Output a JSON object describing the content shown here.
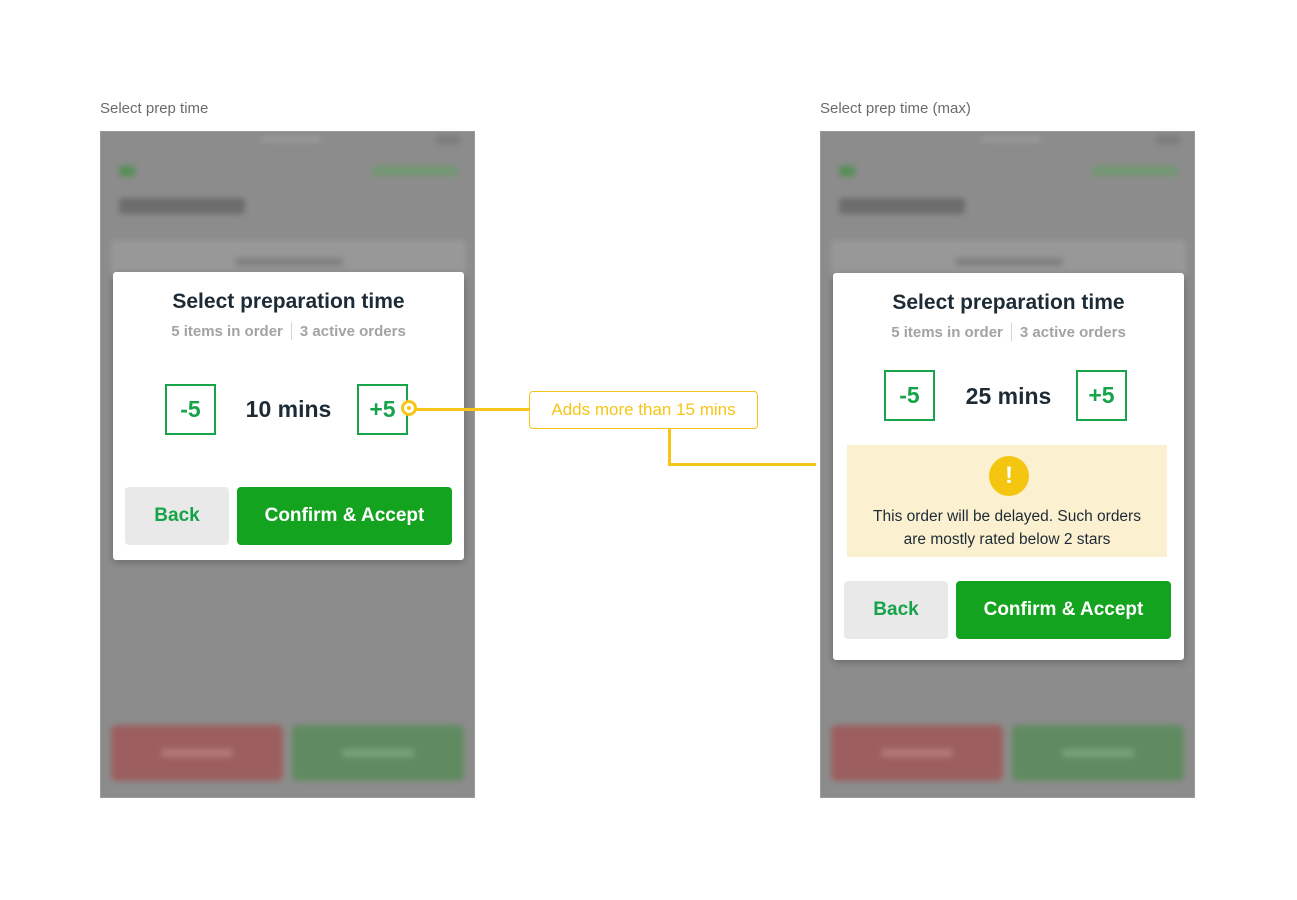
{
  "left_frame": {
    "caption": "Select prep time",
    "modal": {
      "title": "Select preparation time",
      "items_in_order": "5 items in order",
      "active_orders": "3 active orders",
      "minus_label": "-5",
      "time_value": "10 mins",
      "plus_label": "+5",
      "back_label": "Back",
      "confirm_label": "Confirm & Accept"
    }
  },
  "right_frame": {
    "caption": "Select prep time (max)",
    "modal": {
      "title": "Select preparation time",
      "items_in_order": "5 items in order",
      "active_orders": "3 active orders",
      "minus_label": "-5",
      "time_value": "25 mins",
      "plus_label": "+5",
      "warning_icon": "!",
      "warning_line1": "This order will be delayed. Such orders",
      "warning_line2": "are mostly rated below 2 stars",
      "back_label": "Back",
      "confirm_label": "Confirm & Accept"
    }
  },
  "annotation": {
    "label": "Adds more than 15 mins"
  },
  "colors": {
    "accent_green": "#16a34a",
    "confirm_green": "#14a31f",
    "annotation_yellow": "#f5c518",
    "warning_bg": "#fbf0cf",
    "text_dark": "#1d2b36"
  }
}
